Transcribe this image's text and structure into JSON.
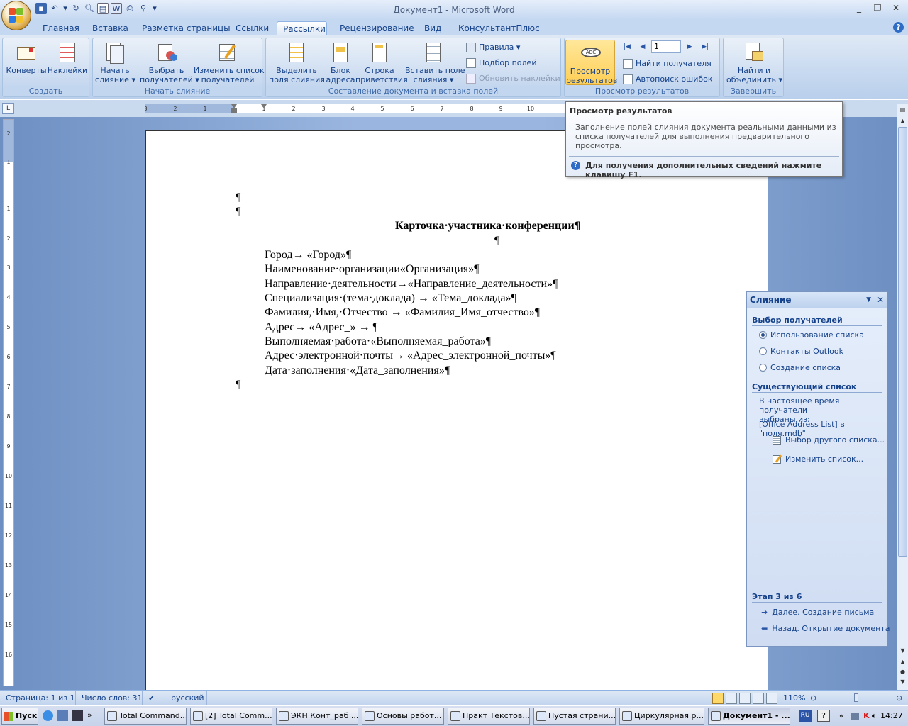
{
  "window": {
    "title": "Документ1 - Microsoft Word",
    "minimize": "_",
    "restore": "❐",
    "close": "✕"
  },
  "ribbon_tabs": [
    "Главная",
    "Вставка",
    "Разметка страницы",
    "Ссылки",
    "Рассылки",
    "Рецензирование",
    "Вид",
    "КонсультантПлюс"
  ],
  "active_tab": "Рассылки",
  "groups": {
    "create": {
      "label": "Создать",
      "envelopes": "Конверты",
      "labels": "Наклейки"
    },
    "start": {
      "label": "Начать слияние",
      "start_merge": [
        "Начать",
        "слияние ▾"
      ],
      "select_recipients": [
        "Выбрать",
        "получателей ▾"
      ],
      "edit_list": [
        "Изменить список",
        "получателей"
      ]
    },
    "compose": {
      "label": "Составление документа и вставка полей",
      "highlight": [
        "Выделить",
        "поля слияния"
      ],
      "address_block": [
        "Блок",
        "адреса"
      ],
      "greeting": [
        "Строка",
        "приветствия"
      ],
      "insert_field": [
        "Вставить поле",
        "слияния ▾"
      ],
      "rules": "Правила ▾",
      "match_fields": "Подбор полей",
      "update_labels": "Обновить наклейки"
    },
    "preview": {
      "label": "Просмотр результатов",
      "preview_btn": [
        "Просмотр",
        "результатов"
      ],
      "record": "1",
      "find_recipient": "Найти получателя",
      "auto_check": "Автопоиск ошибок",
      "nav_first": "|◀",
      "nav_prev": "◀",
      "nav_next": "▶",
      "nav_last": "▶|"
    },
    "finish": {
      "label": "Завершить",
      "finish_btn": [
        "Найти и",
        "объединить ▾"
      ]
    }
  },
  "tooltip": {
    "title": "Просмотр результатов",
    "body": [
      "Заполнение полей слияния документа реальными данными из",
      "списка получателей для выполнения предварительного",
      "просмотра."
    ],
    "help": "Для получения дополнительных сведений нажмите клавишу F1."
  },
  "document": {
    "empty_para": "¶",
    "title": "Карточка·участника·конференции¶",
    "lines": [
      "Город→ «Город»¶",
      "Наименование·организации«Организация»¶",
      "Направление·деятельности→«Направление_деятельности»¶",
      "Специализация·(тема·доклада)  →   «Тема_доклада»¶",
      "Фамилия,·Имя,·Отчество → «Фамилия_Имя_отчество»¶",
      "Адрес→ «Адрес_» → ¶",
      "Выполняемая·работа·«Выполняемая_работа»¶",
      "Адрес·электронной·почты→ «Адрес_электронной_почты»¶",
      "Дата·заполнения·«Дата_заполнения»¶"
    ]
  },
  "ruler": {
    "h_labels": [
      "3",
      "2",
      "1",
      "1",
      "2",
      "3",
      "4",
      "5",
      "6",
      "7",
      "8",
      "9",
      "10"
    ],
    "v_labels": [
      "2",
      "1",
      "1",
      "2",
      "3",
      "4",
      "5",
      "6",
      "7",
      "8",
      "9",
      "10",
      "11",
      "12",
      "13",
      "14",
      "15",
      "16"
    ]
  },
  "taskpane": {
    "title": "Слияние",
    "section1": "Выбор получателей",
    "options": [
      "Использование списка",
      "Контакты Outlook",
      "Создание списка"
    ],
    "selected": 0,
    "section2": "Существующий список",
    "info": [
      "В настоящее время получатели",
      "выбраны из:"
    ],
    "source": "[Office Address List] в \"поля.mdb\"",
    "link_select": "Выбор другого списка...",
    "link_edit": "Изменить список...",
    "step": "Этап 3 из 6",
    "next": "Далее. Создание письма",
    "back": "Назад. Открытие документа"
  },
  "status": {
    "page": "Страница: 1 из 1",
    "words": "Число слов: 31",
    "lang": "русский",
    "zoom": "110%"
  },
  "taskbar": {
    "start": "Пуск",
    "buttons": [
      "Total Command...",
      "[2] Total Comm...",
      "ЭКН Конт_раб ...",
      "Основы работ...",
      "Практ Текстов...",
      "Пустая страни...",
      "Циркулярная р...",
      "Документ1 - ..."
    ],
    "active": 7,
    "lang": "RU",
    "time": "14:27"
  },
  "colors": {
    "accent": "#15428b",
    "ribbon": "#c7d9f0",
    "workspace": "#9ab6e0",
    "highlight": "#ffd86a"
  }
}
